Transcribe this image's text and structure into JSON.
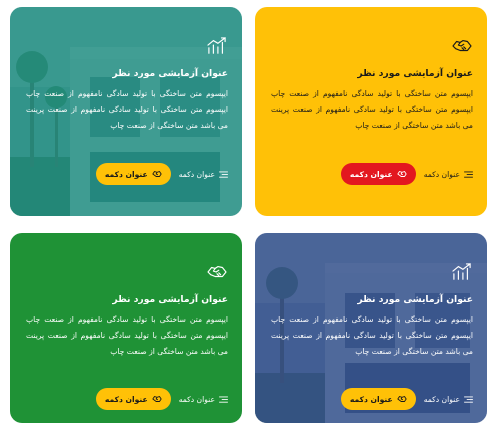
{
  "cards": [
    {
      "title": "عنوان آزمایشی مورد نظر",
      "description": "ایپسوم متن ساختگی با تولید سادگی نامفهوم از صنعت چاپ ایپسوم متن ساختگی با تولید سادگی نامفهوم از صنعت پرینت می باشد متن ساختگی از صنعت چاپ",
      "icon": "handshake-icon",
      "link_label": "عنوان دکمه",
      "button_label": "عنوان دکمه",
      "background": "#ffc107",
      "text_color": "#1a1a1a",
      "button_bg": "#e3171f",
      "button_text_color": "#ffffff"
    },
    {
      "title": "عنوان آزمایشی مورد نظر",
      "description": "ایپسوم متن ساختگی با تولید سادگی نامفهوم از صنعت چاپ ایپسوم متن ساختگی با تولید سادگی نامفهوم از صنعت پرینت می باشد متن ساختگی از صنعت چاپ",
      "icon": "bar-chart-icon",
      "link_label": "عنوان دکمه",
      "button_label": "عنوان دکمه",
      "background": "#1a8a7e",
      "text_color": "#ffffff",
      "button_bg": "#ffc107",
      "button_text_color": "#1a1a1a"
    },
    {
      "title": "عنوان آزمایشی مورد نظر",
      "description": "ایپسوم متن ساختگی با تولید سادگی نامفهوم از صنعت چاپ ایپسوم متن ساختگی با تولید سادگی نامفهوم از صنعت پرینت می باشد متن ساختگی از صنعت چاپ",
      "icon": "bar-chart-icon",
      "link_label": "عنوان دکمه",
      "button_label": "عنوان دکمه",
      "background": "#2c4a86",
      "text_color": "#ffffff",
      "button_bg": "#ffc107",
      "button_text_color": "#1a1a1a"
    },
    {
      "title": "عنوان آزمایشی مورد نظر",
      "description": "ایپسوم متن ساختگی با تولید سادگی نامفهوم از صنعت چاپ ایپسوم متن ساختگی با تولید سادگی نامفهوم از صنعت پرینت می باشد متن ساختگی از صنعت چاپ",
      "icon": "handshake-icon",
      "link_label": "عنوان دکمه",
      "button_label": "عنوان دکمه",
      "background": "#1f9236",
      "text_color": "#ffffff",
      "button_bg": "#ffc107",
      "button_text_color": "#1a1a1a"
    }
  ]
}
